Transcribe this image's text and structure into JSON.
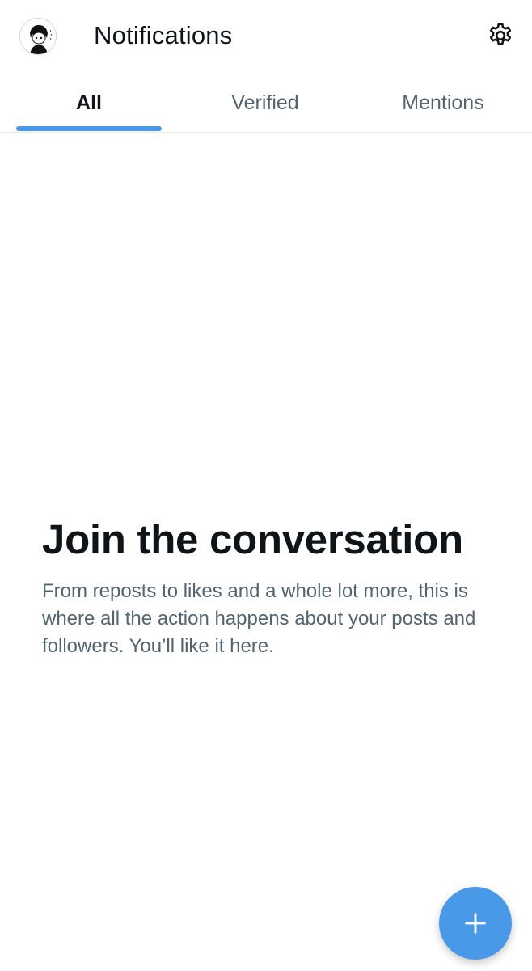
{
  "header": {
    "title": "Notifications",
    "avatar_icon": "profile-avatar",
    "settings_icon": "gear-icon"
  },
  "tabs": [
    {
      "label": "All",
      "active": true
    },
    {
      "label": "Verified",
      "active": false
    },
    {
      "label": "Mentions",
      "active": false
    }
  ],
  "empty_state": {
    "title": "Join the conversation",
    "body": "From reposts to likes and a whole lot more, this is where all the action happens about your posts and followers. You’ll like it here."
  },
  "fab": {
    "icon": "plus-icon"
  },
  "colors": {
    "accent": "#4a99e9",
    "text_primary": "#0f1419",
    "text_secondary": "#536471",
    "divider": "#e6ecf0"
  }
}
